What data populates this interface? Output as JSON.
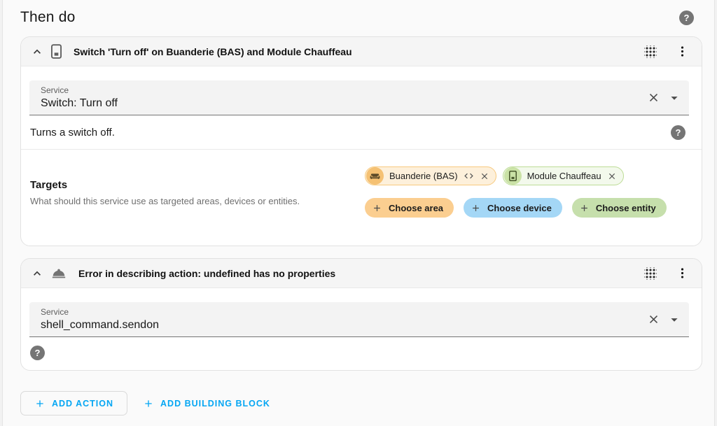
{
  "colors": {
    "accent_blue": "#04a6f3",
    "area_chip_bg": "#fdf0db",
    "area_chip_border": "#f7c97e",
    "area_avatar_bg": "#f5c173",
    "device_chip_bg": "#f3f9ec",
    "device_chip_border": "#bddc96",
    "device_avatar_bg": "#cae2a6",
    "choose_area_bg": "#fbce90",
    "choose_device_bg": "#a4d7f6",
    "choose_entity_bg": "#c6dfac"
  },
  "page": {
    "title": "Then do",
    "help_glyph": "?"
  },
  "cards": [
    {
      "title": "Switch 'Turn off' on Buanderie (BAS) and Module Chauffeau",
      "service_field": {
        "label": "Service",
        "value": "Switch: Turn off"
      },
      "description": "Turns a switch off.",
      "help_glyph": "?",
      "targets": {
        "title": "Targets",
        "subtitle": "What should this service use as targeted areas, devices or entities.",
        "selected": [
          {
            "label": "Buanderie (BAS)",
            "kind": "area"
          },
          {
            "label": "Module Chauffeau",
            "kind": "device"
          }
        ],
        "choosers": [
          {
            "label": "Choose area"
          },
          {
            "label": "Choose device"
          },
          {
            "label": "Choose entity"
          }
        ]
      }
    },
    {
      "title": "Error in describing action: undefined has no properties",
      "service_field": {
        "label": "Service",
        "value": "shell_command.sendon"
      },
      "help_glyph": "?"
    }
  ],
  "footer": {
    "add_action": "ADD ACTION",
    "add_building_block": "ADD BUILDING BLOCK"
  }
}
